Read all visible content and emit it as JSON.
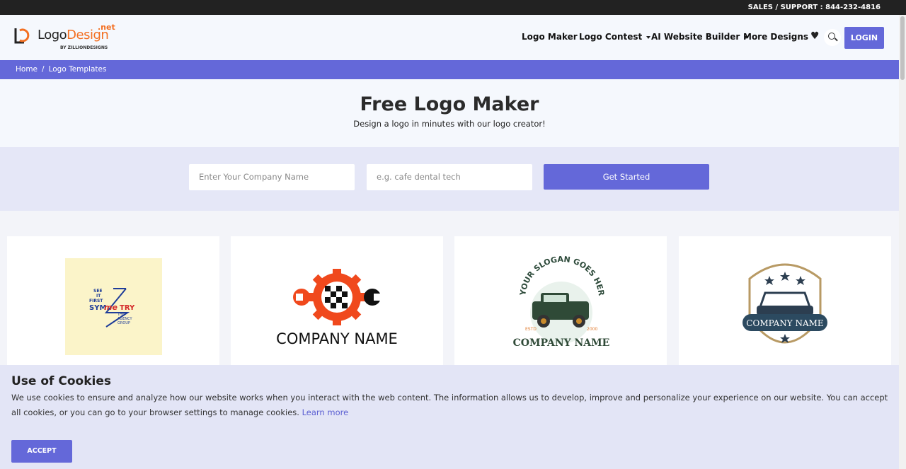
{
  "topbar": {
    "support_text": "SALES / SUPPORT : 844-232-4816"
  },
  "header": {
    "logo": {
      "word1": "Logo",
      "word2": "Design",
      "suffix": ".net",
      "by_line": "BY ZILLIONDESIGNS"
    },
    "nav": [
      {
        "label": "Logo Maker",
        "dropdown": false
      },
      {
        "label": "Logo Contest",
        "dropdown": true
      },
      {
        "label": "AI Website Builder",
        "dropdown": true
      },
      {
        "label": "More Designs",
        "dropdown": true
      }
    ],
    "login_label": "LOGIN",
    "icons": [
      "heart-icon",
      "search-icon"
    ]
  },
  "breadcrumb": {
    "home": "Home",
    "separator": "/",
    "current": "Logo Templates"
  },
  "hero": {
    "title": "Free Logo Maker",
    "subtitle": "Design a logo in minutes with our logo creator!"
  },
  "search": {
    "company_placeholder": "Enter Your Company Name",
    "keyword_placeholder": "e.g. cafe dental tech",
    "button_label": "Get Started"
  },
  "templates": [
    {
      "lines": [
        "SEE",
        "IT",
        "FIRST",
        "SYM",
        "me",
        "TRY",
        "THE",
        "AGENCY",
        "GROUP"
      ],
      "bg": "#fbf4c9"
    },
    {
      "company": "COMPANY NAME"
    },
    {
      "slogan": "YOUR SLOGAN GOES HERE",
      "estd": "ESTD",
      "year": "2000",
      "company": "COMPANY NAME"
    },
    {
      "company": "COMPANY NAME"
    }
  ],
  "cookie": {
    "title": "Use of Cookies",
    "body": "We use cookies to ensure and analyze how our website works when you interact with the web content. The information allows us to develop, improve and personalize your experience on our website. You can accept all cookies, or you can go to your browser settings to manage cookies.",
    "link": "Learn more",
    "accept_label": "ACCEPT"
  },
  "colors": {
    "primary": "#6468d9",
    "topbar": "#222222",
    "accent": "#f36f21"
  }
}
